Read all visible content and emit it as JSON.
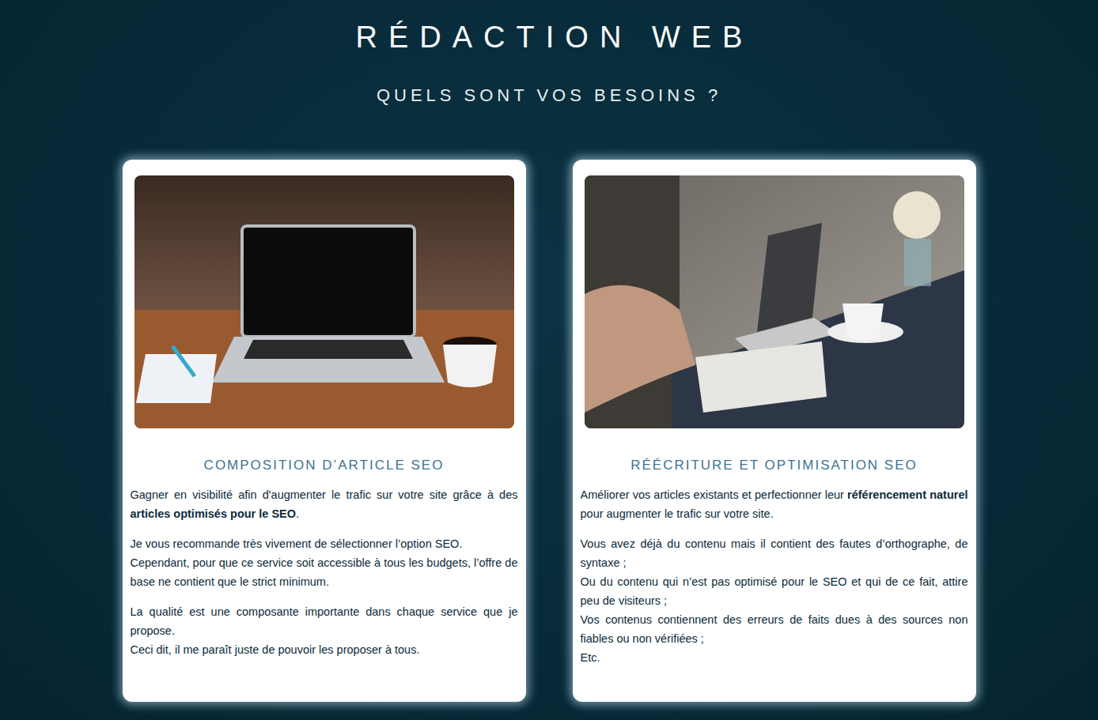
{
  "title": "RÉDACTION WEB",
  "subtitle": "QUELS SONT VOS BESOINS ?",
  "cards": [
    {
      "heading": "COMPOSITION D’ARTICLE SEO",
      "paragraphs": [
        {
          "lines": [
            {
              "segments": [
                {
                  "text": "Gagner en visibilité afin d'augmenter le trafic sur votre site grâce à des ",
                  "bold": false
                },
                {
                  "text": "articles optimisés pour le SEO",
                  "bold": true
                },
                {
                  "text": ".",
                  "bold": false
                }
              ]
            }
          ]
        },
        {
          "lines": [
            {
              "segments": [
                {
                  "text": "Je vous recommande très vivement de sélectionner l’option SEO.",
                  "bold": false
                }
              ]
            },
            {
              "segments": [
                {
                  "text": "Cependant, pour que ce service soit accessible à tous les budgets, l’offre de base ne contient que le strict minimum.",
                  "bold": false
                }
              ]
            }
          ]
        },
        {
          "lines": [
            {
              "segments": [
                {
                  "text": "La qualité est une composante importante dans chaque service que je propose.",
                  "bold": false
                }
              ]
            },
            {
              "segments": [
                {
                  "text": "Ceci dit, il me paraît juste de pouvoir les proposer à tous.",
                  "bold": false
                }
              ]
            }
          ]
        }
      ]
    },
    {
      "heading": "RÉÉCRITURE ET OPTIMISATION SEO",
      "paragraphs": [
        {
          "lines": [
            {
              "segments": [
                {
                  "text": "Améliorer vos articles existants et perfectionner leur ",
                  "bold": false
                },
                {
                  "text": "référencement naturel",
                  "bold": true
                },
                {
                  "text": " pour augmenter le trafic sur votre site.",
                  "bold": false
                }
              ]
            }
          ]
        },
        {
          "lines": [
            {
              "segments": [
                {
                  "text": "Vous avez déjà du contenu mais il contient des fautes d’orthographe, de syntaxe ;",
                  "bold": false
                }
              ]
            },
            {
              "segments": [
                {
                  "text": "Ou du contenu qui n’est pas optimisé pour le SEO et qui de ce fait, attire peu de visiteurs ;",
                  "bold": false
                }
              ]
            },
            {
              "segments": [
                {
                  "text": "Vos contenus contiennent des erreurs de faits dues à des sources non fiables ou non vérifiées ;",
                  "bold": false
                }
              ]
            },
            {
              "segments": [
                {
                  "text": "Etc.",
                  "bold": false
                }
              ]
            }
          ]
        }
      ]
    }
  ]
}
